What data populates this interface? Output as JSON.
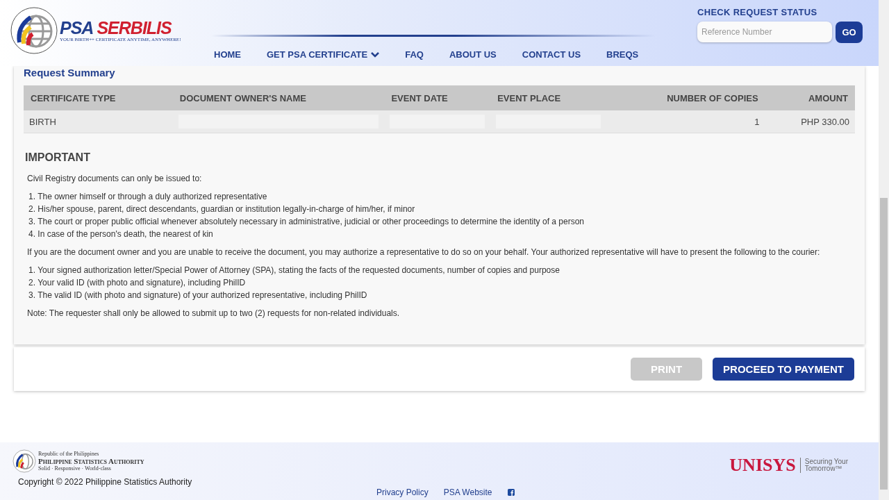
{
  "header": {
    "brand_first": "PSA",
    "brand_second": "SERBILIS",
    "tagline": "YOUR BIRTH++ CERTIFICATE ANYTIME, ANYWHERE!",
    "nav": [
      {
        "label": "HOME",
        "has_caret": false
      },
      {
        "label": "GET PSA CERTIFICATE",
        "has_caret": true
      },
      {
        "label": "FAQ",
        "has_caret": false
      },
      {
        "label": "ABOUT US",
        "has_caret": false
      },
      {
        "label": "CONTACT US",
        "has_caret": false
      },
      {
        "label": "BREQS",
        "has_caret": false
      }
    ],
    "status_check": {
      "title": "CHECK REQUEST STATUS",
      "placeholder": "Reference Number",
      "button": "GO"
    }
  },
  "summary": {
    "title": "Request Summary",
    "columns": [
      "CERTIFICATE TYPE",
      "DOCUMENT OWNER'S NAME",
      "EVENT DATE",
      "EVENT PLACE",
      "NUMBER OF COPIES",
      "AMOUNT"
    ],
    "rows": [
      {
        "cells": [
          {
            "kind": "text",
            "text": "BIRTH"
          },
          {
            "kind": "redacted"
          },
          {
            "kind": "redacted"
          },
          {
            "kind": "redacted"
          },
          {
            "kind": "text",
            "text": "1"
          },
          {
            "kind": "text",
            "text": "PHP 330.00"
          }
        ]
      }
    ]
  },
  "important": {
    "title": "IMPORTANT",
    "intro": "Civil Registry documents can only be issued to:",
    "who": [
      "1. The owner himself or through a duly authorized representative",
      "2. His/her spouse, parent, direct descendants, guardian or institution legally-in-charge of him/her, if minor",
      "3. The court or proper public official whenever absolutely necessary in administrative, judicial or other proceedings to determine the identity of a person",
      "4. In case of the person's death, the nearest of kin"
    ],
    "representative": "If you are the document owner and you are unable to receive the document, you may authorize a representative to do so on your behalf. Your authorized representative will have to present the following to the courier:",
    "requirements": [
      "1. Your signed authorization letter/Special Power of Attorney (SPA), stating the facts of the requested documents, number of copies and purpose",
      "2. Your valid ID (with photo and signature), including PhilID",
      "3. The valid ID (with photo and signature) of your authorized representative, including PhilID"
    ],
    "note": "Note: The requester shall only be allowed to submit up to two (2) requests for non-related individuals."
  },
  "actions": [
    {
      "label": "PRINT",
      "disabled": true
    },
    {
      "label": "PROCEED TO PAYMENT",
      "disabled": false
    }
  ],
  "footer": {
    "org_small": "Republic of the Philippines",
    "org_name": "Philippine Statistics Authority",
    "org_motto": "Solid · Responsive · World-class",
    "copyright": "Copyright © 2022 Philippine Statistics Authority",
    "links": [
      {
        "kind": "text",
        "label": "Privacy Policy"
      },
      {
        "kind": "text",
        "label": "PSA Website"
      },
      {
        "kind": "facebook"
      }
    ],
    "partner": "UNISYS",
    "partner_slogan_1": "Securing Your",
    "partner_slogan_2": "Tomorrow™"
  }
}
